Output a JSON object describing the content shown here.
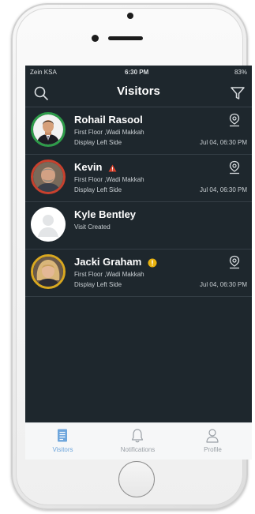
{
  "status_bar": {
    "carrier": "Zein KSA",
    "time": "6:30 PM",
    "battery": "83%"
  },
  "header": {
    "title": "Visitors"
  },
  "visitors": [
    {
      "name": "Rohail Rasool",
      "line1": "First Floor ,Wadi Makkah",
      "line2": "Display Left Side",
      "date": "Jul 04, 06:30 PM",
      "ring_color": "#2e9c4a",
      "badge": ""
    },
    {
      "name": "Kevin",
      "line1": "First Floor ,Wadi Makkah",
      "line2": "Display Left Side",
      "date": "Jul 04, 06:30 PM",
      "ring_color": "#c8412e",
      "badge": "warning-triangle-icon"
    },
    {
      "name": "Kyle Bentley",
      "line1": "Visit Created",
      "line2": "",
      "date": "",
      "ring_color": "#ffffff",
      "badge": ""
    },
    {
      "name": "Jacki Graham",
      "line1": "First Floor ,Wadi Makkah",
      "line2": "Display Left Side",
      "date": "Jul 04, 06:30 PM",
      "ring_color": "#d9a820",
      "badge": "exclamation-circle-icon"
    }
  ],
  "tabs": [
    {
      "label": "Visitors",
      "icon": "document-icon",
      "active": true
    },
    {
      "label": "Notifications",
      "icon": "bell-icon",
      "active": false
    },
    {
      "label": "Profile",
      "icon": "person-icon",
      "active": false
    }
  ],
  "colors": {
    "screen_bg": "#1e272d",
    "accent": "#6ea6dc",
    "warning": "#d9412b",
    "alert": "#e9b20e"
  }
}
